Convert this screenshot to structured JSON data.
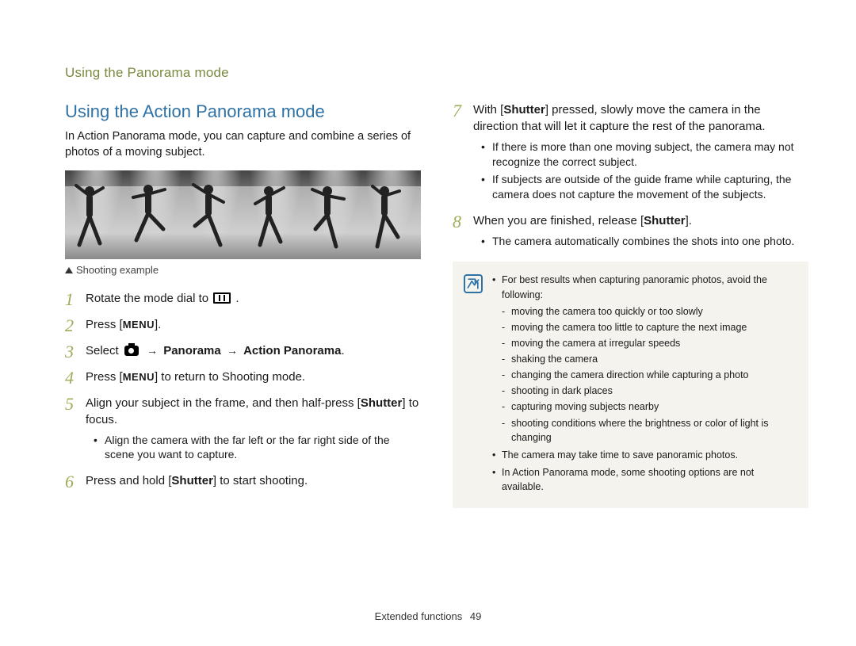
{
  "header": "Using the Panorama mode",
  "section_title": "Using the Action Panorama mode",
  "intro": "In Action Panorama mode, you can capture and combine a series of photos of a moving subject.",
  "example_caption": "Shooting example",
  "steps_left": [
    {
      "num": "1",
      "parts": [
        "Rotate the mode dial to ",
        {
          "icon": "pano"
        },
        " ."
      ]
    },
    {
      "num": "2",
      "parts": [
        "Press [",
        {
          "icon": "menu"
        },
        "]."
      ]
    },
    {
      "num": "3",
      "parts": [
        "Select ",
        {
          "icon": "camera"
        },
        " ",
        {
          "arrow": "→"
        },
        " ",
        {
          "bold": "Panorama"
        },
        " ",
        {
          "arrow": "→"
        },
        " ",
        {
          "bold": "Action Panorama"
        },
        "."
      ]
    },
    {
      "num": "4",
      "parts": [
        "Press [",
        {
          "icon": "menu"
        },
        "] to return to Shooting mode."
      ]
    },
    {
      "num": "5",
      "parts": [
        "Align your subject in the frame, and then half-press [",
        {
          "bold": "Shutter"
        },
        "] to focus."
      ],
      "subs": [
        "Align the camera with the far left or the far right side of the scene you want to capture."
      ]
    },
    {
      "num": "6",
      "parts": [
        "Press and hold [",
        {
          "bold": "Shutter"
        },
        "] to start shooting."
      ]
    }
  ],
  "steps_right": [
    {
      "num": "7",
      "parts": [
        "With [",
        {
          "bold": "Shutter"
        },
        "] pressed, slowly move the camera in the direction that will let it capture the rest of the panorama."
      ],
      "subs": [
        "If there is more than one moving subject, the camera may not recognize the correct subject.",
        "If subjects are outside of the guide frame while capturing, the camera does not capture the movement of the subjects."
      ]
    },
    {
      "num": "8",
      "parts": [
        "When you are finished, release [",
        {
          "bold": "Shutter"
        },
        "]."
      ],
      "subs": [
        "The camera automatically combines the shots into one photo."
      ]
    }
  ],
  "note": {
    "lead": "For best results when capturing panoramic photos, avoid the following:",
    "items": [
      "moving the camera too quickly or too slowly",
      "moving the camera too little to capture the next image",
      "moving the camera at irregular speeds",
      "shaking the camera",
      "changing the camera direction while capturing a photo",
      "shooting in dark places",
      "capturing moving subjects nearby",
      "shooting conditions where the brightness or color of light is changing"
    ],
    "extra": [
      "The camera may take time to save panoramic photos.",
      "In Action Panorama mode, some shooting options are not available."
    ]
  },
  "footer": {
    "section": "Extended functions",
    "page": "49"
  }
}
